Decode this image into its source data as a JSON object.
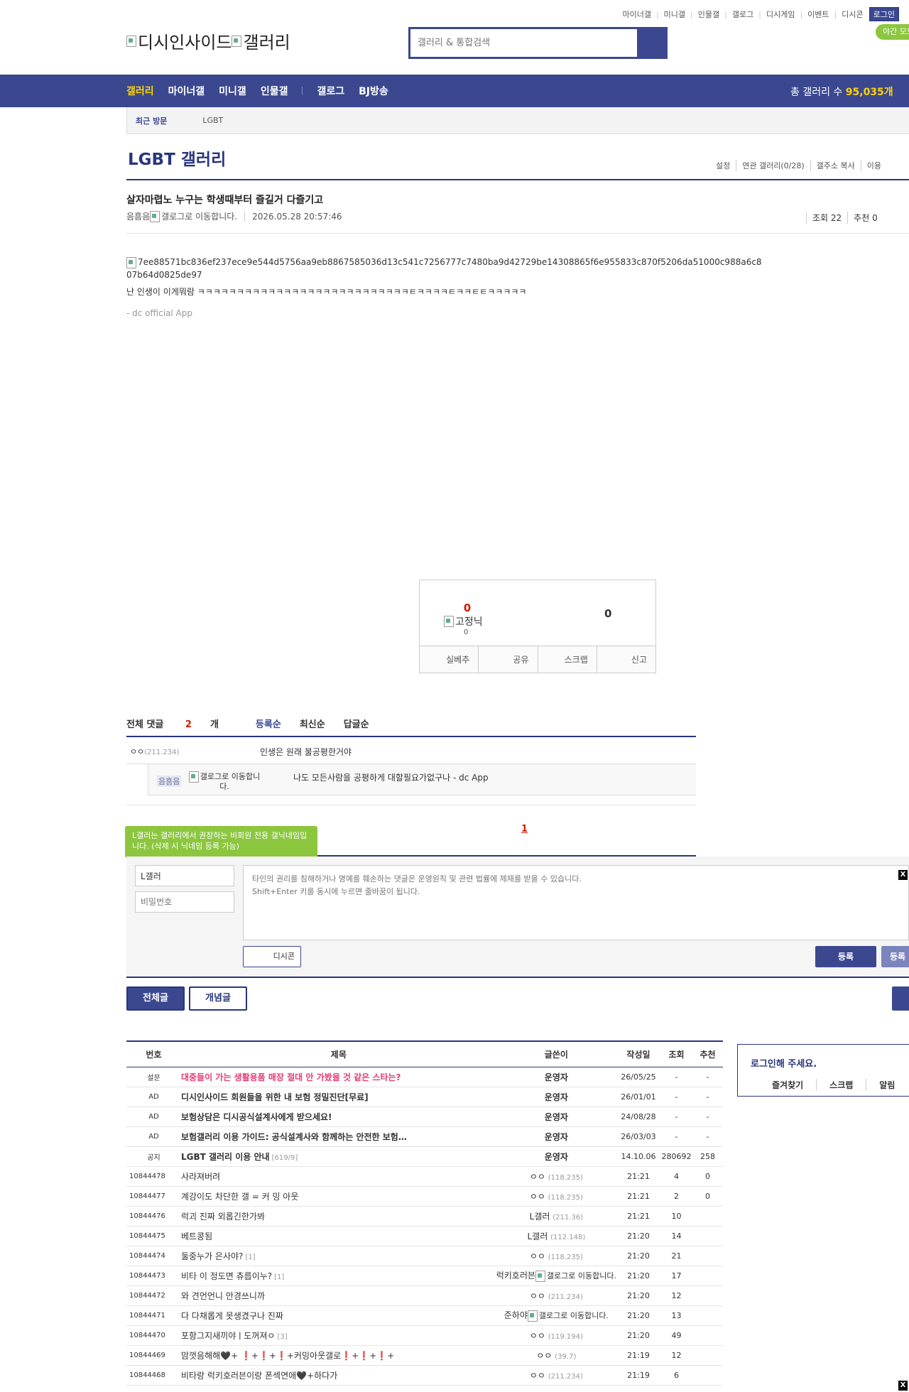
{
  "top_links": [
    "마이너갤",
    "미니갤",
    "인물갤",
    "갤로그",
    "디시게임",
    "이벤트",
    "디시콘"
  ],
  "login_label": "로그인",
  "night_mode": "야간 모드",
  "logo": {
    "site": "디시인사이드",
    "section": "갤러리"
  },
  "search": {
    "placeholder": "갤러리 & 통합검색"
  },
  "nav": {
    "items": [
      "갤러리",
      "마이너갤",
      "미니갤",
      "인물갤",
      "갤로그",
      "BJ방송"
    ],
    "total_label": "총 갤러리 수 ",
    "total_value": "95,035개"
  },
  "recent": {
    "label": "최근 방문",
    "item": "LGBT"
  },
  "gallery": {
    "title": "LGBT 갤러리",
    "tools": [
      "설정",
      "연관 갤러리(0/28)",
      "갤주소 복사",
      "이용"
    ]
  },
  "post": {
    "title": "살자마렵노 누구는 학생때부터 즐길거 다즐기고",
    "author": "음흠음",
    "gallog_alt": "갤로그로 이동합니다.",
    "date": "2026.05.28 20:57:46",
    "views": "조회 22",
    "recommend": "추천 0",
    "image_alt": "7ee88571bc836ef237ece9e544d5756aa9eb8867585036d13c541c7256777c7480ba9d42729be14308865f6e955833c870f5206da51000c988a6c807b64d0825de97",
    "body": "난 인생이 이게뭐람 ㅋㅋㅋㅋㅋㅋㅋㅋㅋㅋㅋㅋㅋㅋㅋㅋㅋㅋㅋㅋㅋㅋㅋㅋㅋㅋㅋㅌㅋㅋㅋㅋㅌㅋㅋㅌㅌㅋㅋㅋㅋㅋ",
    "app": "- dc official App"
  },
  "recommend_box": {
    "up": "0",
    "fix_label": "고정닉",
    "fix_count": "0",
    "down": "0",
    "buttons": [
      "실베추",
      "공유",
      "스크랩",
      "신고"
    ]
  },
  "comments": {
    "header": {
      "total_label": "전체 댓글 ",
      "count": "2",
      "unit": "개",
      "sorts": [
        "등록순",
        "최신순",
        "답글순"
      ]
    },
    "items": [
      {
        "nick": "ㅇㅇ",
        "ip": "(211.234)",
        "text": "인생은 원래 불공평한거야"
      },
      {
        "nick": "음흠음",
        "gallog": "갤로그로 이동합니다.",
        "text": "나도 모든사람을 공평하게 대할필요가없구나 - dc App"
      }
    ],
    "page": "1",
    "tip": "L갤러는 갤러리에서 권장하는 비회원 전용 갤닉네임입니다. (삭제 시 닉네임 등록 가능)",
    "name_value": "L갤러",
    "password_placeholder": "비밀번호",
    "textarea_placeholder": "타인의 권리를 침해하거나 명예를 훼손하는 댓글은 운영원칙 및 관련 법률에 제재를 받을 수 있습니다.\nShift+Enter 키를 동시에 누르면 줄바꿈이 됩니다.",
    "dccon": "디시콘",
    "submit": "등록",
    "submit2": "등록"
  },
  "close_x": "X",
  "tabs": [
    "전체글",
    "개념글"
  ],
  "list": {
    "headers": [
      "번호",
      "제목",
      "글쓴이",
      "작성일",
      "조회",
      "추천"
    ],
    "rows": [
      {
        "num": "설문",
        "title": "대중들이 가는 생활용품 매장 절대 안 가봤을 것 같은 스타는?",
        "writer": "운영자",
        "date": "26/05/25",
        "views": "-",
        "rec": "-",
        "style": "red"
      },
      {
        "num": "AD",
        "title": "디시인사이드 회원들을 위한 내 보험 정밀진단[무료]",
        "writer": "운영자",
        "date": "26/01/01",
        "views": "-",
        "rec": "-",
        "style": "bold"
      },
      {
        "num": "AD",
        "title": "보험상담은 디시공식설계사에게 받으세요!",
        "writer": "운영자",
        "date": "24/08/28",
        "views": "-",
        "rec": "-",
        "style": "bold"
      },
      {
        "num": "AD",
        "title": "보험갤러리 이용 가이드: 공식설계사와 함께하는 안전한 보험…",
        "writer": "운영자",
        "date": "26/03/03",
        "views": "-",
        "rec": "-",
        "style": "bold"
      },
      {
        "num": "공지",
        "title": "LGBT 갤러리 이용 안내",
        "reply": "[619/9]",
        "writer": "운영자",
        "date": "14.10.06",
        "views": "280692",
        "rec": "258",
        "style": "bold"
      },
      {
        "num": "10844478",
        "title": "사라져버려",
        "writer": "ㅇㅇ",
        "ip": "(118.235)",
        "date": "21:21",
        "views": "4",
        "rec": "0"
      },
      {
        "num": "10844477",
        "title": "계강이도 차단한 갤 = 커 밍 아웃",
        "writer": "ㅇㅇ",
        "ip": "(118.235)",
        "date": "21:21",
        "views": "2",
        "rec": "0"
      },
      {
        "num": "10844476",
        "title": "럭괴 진짜 외롭긴한가봐",
        "writer": "L갤러",
        "ip": "(211.36)",
        "date": "21:21",
        "views": "10",
        "rec": ""
      },
      {
        "num": "10844475",
        "title": "베트콩됨",
        "writer": "L갤러",
        "ip": "(112.148)",
        "date": "21:20",
        "views": "14",
        "rec": ""
      },
      {
        "num": "10844474",
        "title": "둘중누가 은사야?",
        "reply": "[1]",
        "writer": "ㅇㅇ",
        "ip": "(118.235)",
        "date": "21:20",
        "views": "21",
        "rec": ""
      },
      {
        "num": "10844473",
        "title": "비타 이 정도면 츄릅이누?",
        "reply": "[1]",
        "writer": "럭키호러븐",
        "gallog": "갤로그로 이동합니다.",
        "date": "21:20",
        "views": "17",
        "rec": ""
      },
      {
        "num": "10844472",
        "title": "와 견언언니 안경쓰니까",
        "writer": "ㅇㅇ",
        "ip": "(211.234)",
        "date": "21:20",
        "views": "12",
        "rec": ""
      },
      {
        "num": "10844471",
        "title": "다 다채롭게 못생겼구나 진짜",
        "writer": "준하야",
        "gallog": "갤로그로 이동합니다.",
        "date": "21:20",
        "views": "13",
        "rec": ""
      },
      {
        "num": "10844470",
        "title": "포항그지새끼야ㅣ도꺼져ㅇ",
        "reply": "[3]",
        "writer": "ㅇㅇ",
        "ip": "(119.194)",
        "date": "21:20",
        "views": "49",
        "rec": ""
      },
      {
        "num": "10844469",
        "title": "맘껏음해해🖤+ ❗+❗+❗+커밍아웃갤로❗+❗+❗+",
        "writer": "ㅇㅇ",
        "ip": "(39.7)",
        "date": "21:19",
        "views": "12",
        "rec": ""
      },
      {
        "num": "10844468",
        "title": "비타랑 럭키호러븐이랑 폰섹연애🖤+하다가",
        "writer": "ㅇㅇ",
        "ip": "(211.234)",
        "date": "21:19",
        "views": "6",
        "rec": ""
      }
    ]
  },
  "login_box": {
    "title": "로그인해 주세요.",
    "links": [
      "즐겨찾기",
      "스크랩",
      "알림"
    ]
  }
}
